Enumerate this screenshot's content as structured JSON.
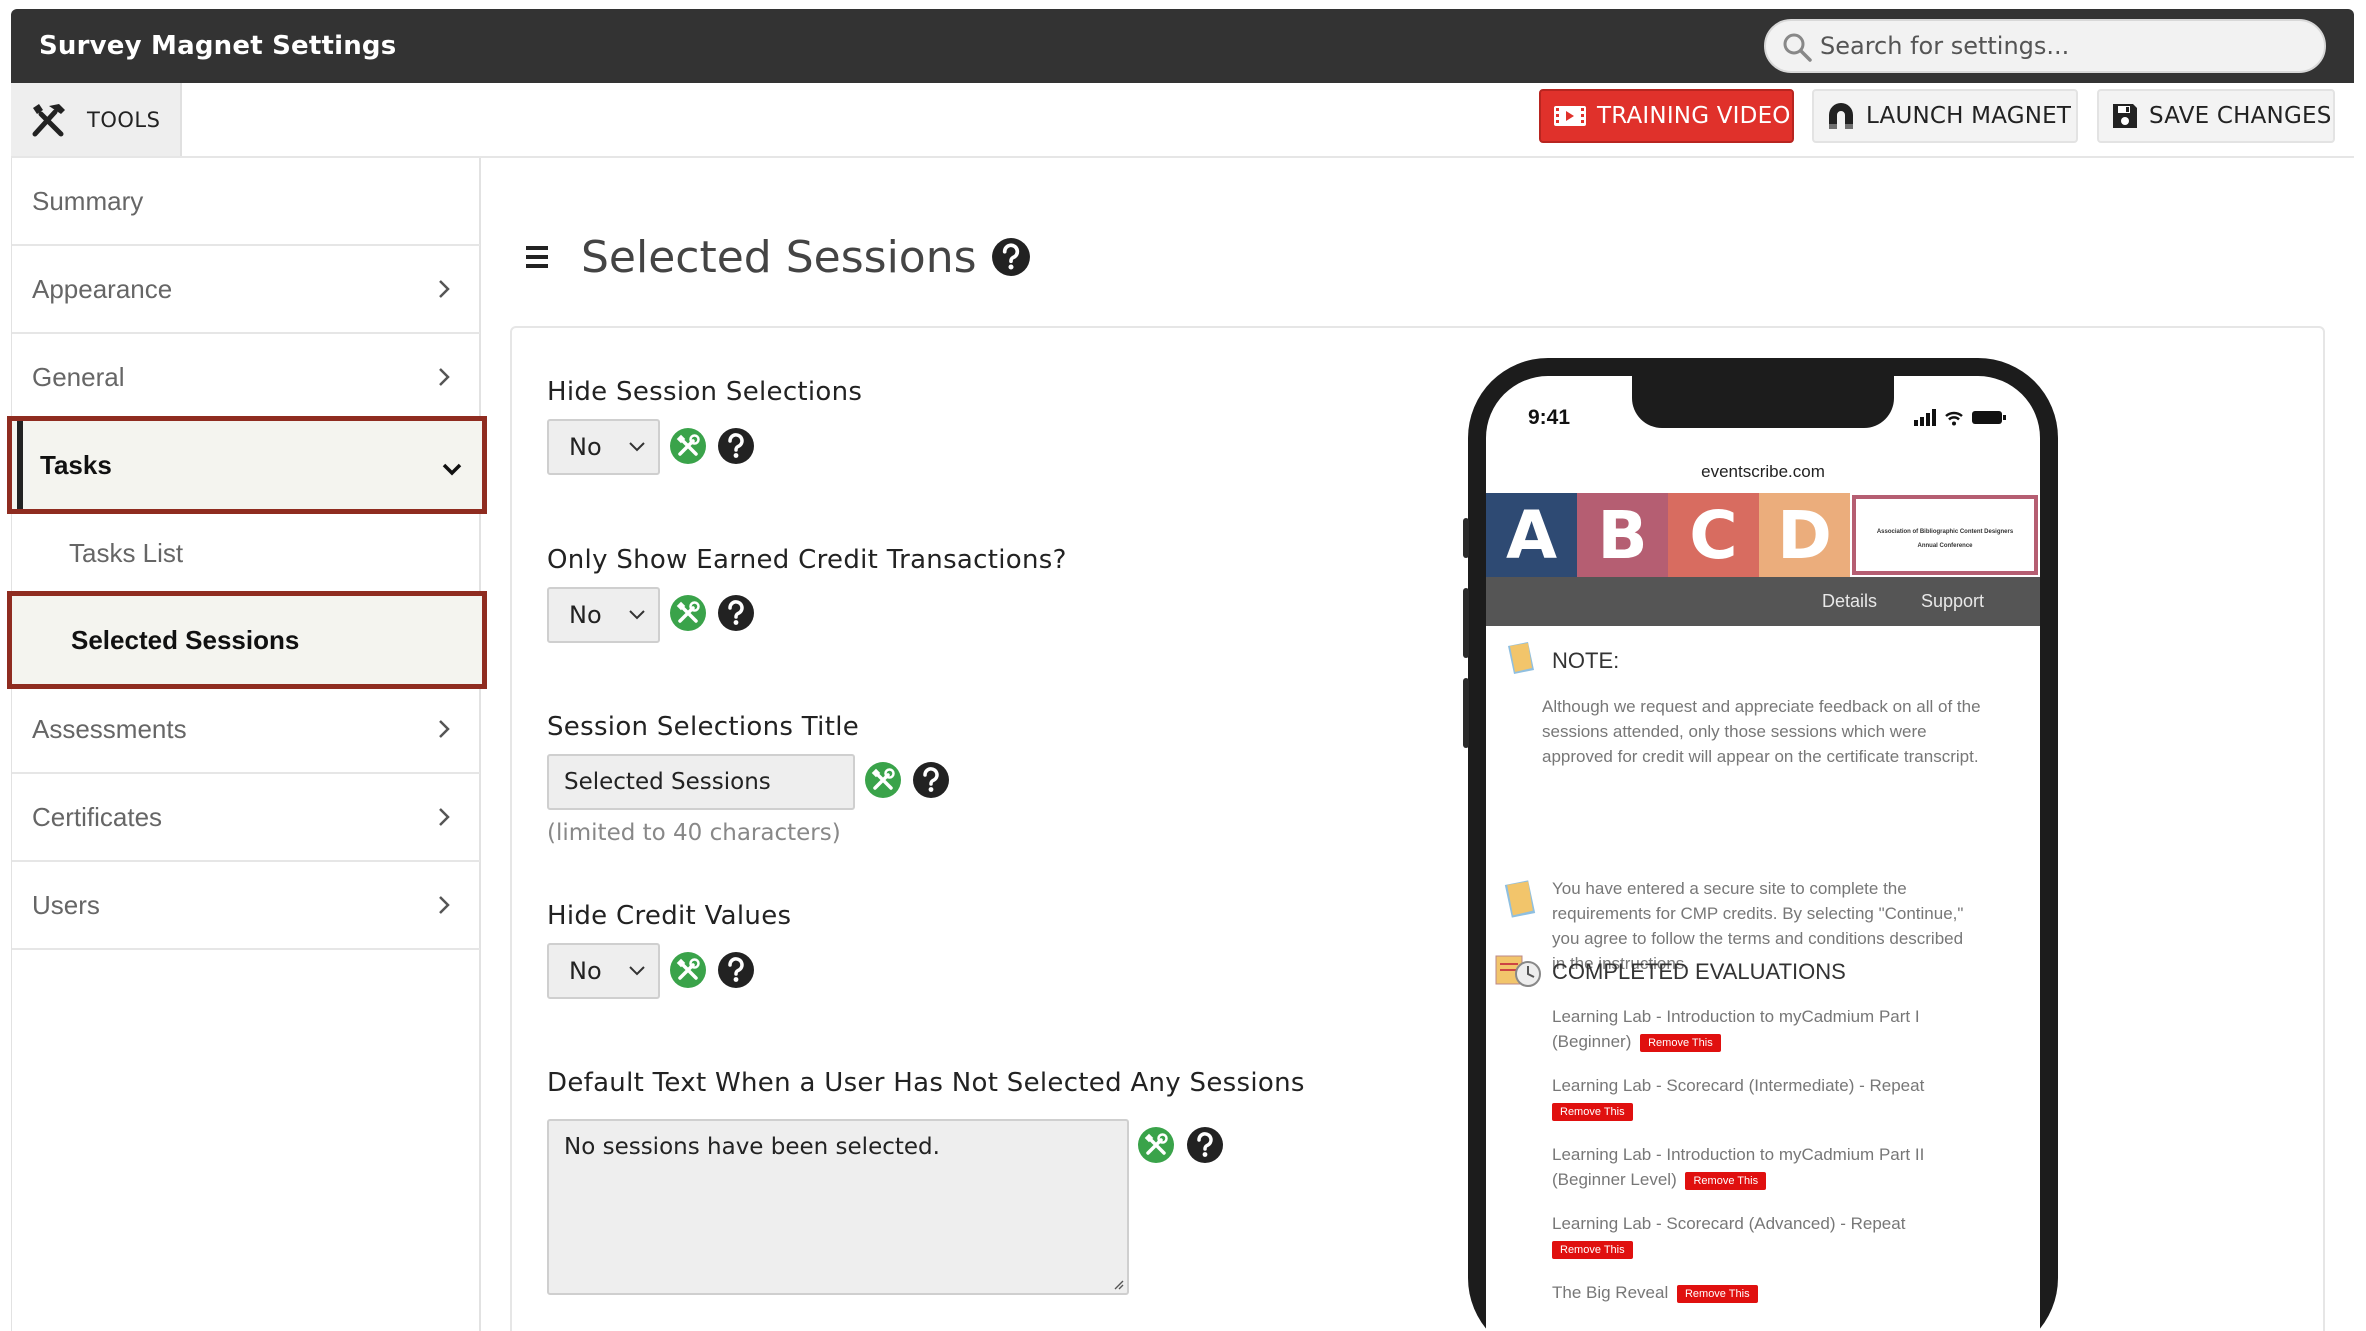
{
  "app": {
    "title": "Survey Magnet Settings"
  },
  "search": {
    "placeholder": "Search for settings..."
  },
  "toolbar": {
    "tools_label": "TOOLS",
    "training_label": "TRAINING VIDEO",
    "launch_label": "LAUNCH MAGNET",
    "save_label": "SAVE CHANGES"
  },
  "sidebar": {
    "items": [
      {
        "label": "Summary"
      },
      {
        "label": "Appearance"
      },
      {
        "label": "General"
      },
      {
        "label": "Tasks"
      },
      {
        "label": "Tasks List"
      },
      {
        "label": "Selected Sessions"
      },
      {
        "label": "Assessments"
      },
      {
        "label": "Certificates"
      },
      {
        "label": "Users"
      }
    ]
  },
  "main": {
    "title": "Selected Sessions",
    "fields": {
      "hide_selections": {
        "label": "Hide Session Selections",
        "value": "No"
      },
      "only_earned": {
        "label": "Only Show Earned Credit Transactions?",
        "value": "No"
      },
      "selections_title": {
        "label": "Session Selections Title",
        "value": "Selected Sessions",
        "hint": "(limited to 40 characters)"
      },
      "hide_credit": {
        "label": "Hide Credit Values",
        "value": "No"
      },
      "default_text": {
        "label": "Default Text When a User Has Not Selected Any Sessions",
        "value": "No sessions have been selected."
      }
    }
  },
  "preview": {
    "time": "9:41",
    "domain": "eventscribe.com",
    "banner_letters": [
      "A",
      "B",
      "C",
      "D"
    ],
    "banner_org": "Association of Bibliographic Content Designers",
    "banner_event": "Annual Conference",
    "nav": {
      "details": "Details",
      "support": "Support"
    },
    "note_title": "NOTE:",
    "note_text": "Although we request and appreciate feedback on all of the sessions attended, only those sessions which were approved for credit will appear on the certificate transcript.",
    "secure_text": "You have entered a secure site to complete the requirements for CMP credits. By selecting \"Continue,\" you agree to follow the terms and conditions described in the instructions.",
    "evals_title": "COMPLETED EVALUATIONS",
    "remove_label": "Remove This",
    "evals": [
      {
        "title": "Learning Lab - Introduction to myCadmium Part I (Beginner)"
      },
      {
        "title": "Learning Lab - Scorecard (Intermediate) - Repeat"
      },
      {
        "title": "Learning Lab - Introduction to myCadmium Part II (Beginner Level)"
      },
      {
        "title": "Learning Lab - Scorecard (Advanced) - Repeat"
      },
      {
        "title": "The Big Reveal"
      }
    ]
  },
  "colors": {
    "topbar": "#333333",
    "training_button": "#e0312b",
    "active_border": "#8f2c20",
    "tool_icon_green": "#3aa34a",
    "help_icon": "#222222"
  },
  "icons": {
    "search": "search-icon",
    "tools": "tools-icon",
    "video": "video-icon",
    "magnet": "magnet-icon",
    "save": "floppy-disk-icon",
    "help": "question-circle-icon",
    "developer": "wrench-screwdriver-icon",
    "menu": "hamburger-menu-icon"
  }
}
